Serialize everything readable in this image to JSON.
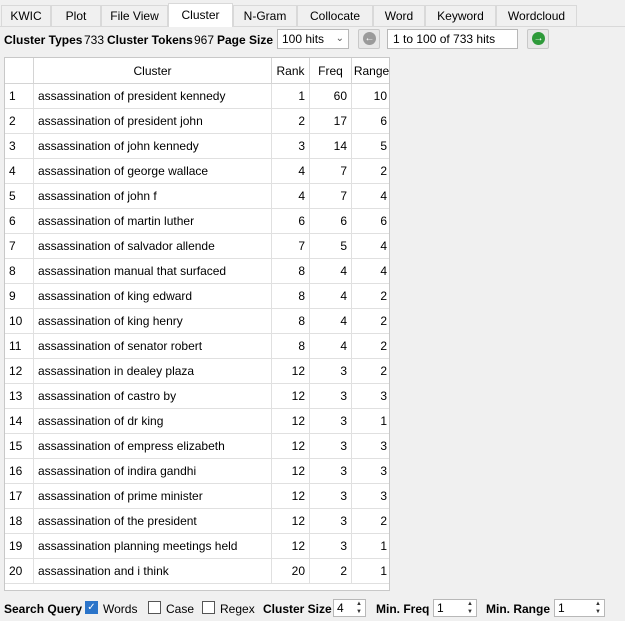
{
  "tabs": [
    {
      "label": "KWIC"
    },
    {
      "label": "Plot"
    },
    {
      "label": "File View"
    },
    {
      "label": "Cluster"
    },
    {
      "label": "N-Gram"
    },
    {
      "label": "Collocate"
    },
    {
      "label": "Word"
    },
    {
      "label": "Keyword"
    },
    {
      "label": "Wordcloud"
    }
  ],
  "active_tab": "Cluster",
  "toolbar": {
    "cluster_types_label": "Cluster Types",
    "cluster_types_value": "733",
    "cluster_tokens_label": "Cluster Tokens",
    "cluster_tokens_value": "967",
    "page_size_label": "Page Size",
    "page_size_value": "100 hits",
    "hits_range": "1 to 100 of 733 hits",
    "prev_icon": "arrow-left-circle-icon",
    "next_icon": "arrow-right-circle-icon",
    "prev_color": "#9a9a9a",
    "next_color": "#2e9a3a"
  },
  "table": {
    "headers": {
      "index": "",
      "cluster": "Cluster",
      "rank": "Rank",
      "freq": "Freq",
      "range": "Range"
    },
    "rows": [
      {
        "index": "1",
        "cluster": "assassination of president kennedy",
        "rank": "1",
        "freq": "60",
        "range": "10"
      },
      {
        "index": "2",
        "cluster": "assassination of president john",
        "rank": "2",
        "freq": "17",
        "range": "6"
      },
      {
        "index": "3",
        "cluster": "assassination of john kennedy",
        "rank": "3",
        "freq": "14",
        "range": "5"
      },
      {
        "index": "4",
        "cluster": "assassination of george wallace",
        "rank": "4",
        "freq": "7",
        "range": "2"
      },
      {
        "index": "5",
        "cluster": "assassination of john f",
        "rank": "4",
        "freq": "7",
        "range": "4"
      },
      {
        "index": "6",
        "cluster": "assassination of martin luther",
        "rank": "6",
        "freq": "6",
        "range": "6"
      },
      {
        "index": "7",
        "cluster": "assassination of salvador allende",
        "rank": "7",
        "freq": "5",
        "range": "4"
      },
      {
        "index": "8",
        "cluster": "assassination manual that surfaced",
        "rank": "8",
        "freq": "4",
        "range": "4"
      },
      {
        "index": "9",
        "cluster": "assassination of king edward",
        "rank": "8",
        "freq": "4",
        "range": "2"
      },
      {
        "index": "10",
        "cluster": "assassination of king henry",
        "rank": "8",
        "freq": "4",
        "range": "2"
      },
      {
        "index": "11",
        "cluster": "assassination of senator robert",
        "rank": "8",
        "freq": "4",
        "range": "2"
      },
      {
        "index": "12",
        "cluster": "assassination in dealey plaza",
        "rank": "12",
        "freq": "3",
        "range": "2"
      },
      {
        "index": "13",
        "cluster": "assassination of castro by",
        "rank": "12",
        "freq": "3",
        "range": "3"
      },
      {
        "index": "14",
        "cluster": "assassination of dr king",
        "rank": "12",
        "freq": "3",
        "range": "1"
      },
      {
        "index": "15",
        "cluster": "assassination of empress elizabeth",
        "rank": "12",
        "freq": "3",
        "range": "3"
      },
      {
        "index": "16",
        "cluster": "assassination of indira gandhi",
        "rank": "12",
        "freq": "3",
        "range": "3"
      },
      {
        "index": "17",
        "cluster": "assassination of prime minister",
        "rank": "12",
        "freq": "3",
        "range": "3"
      },
      {
        "index": "18",
        "cluster": "assassination of the president",
        "rank": "12",
        "freq": "3",
        "range": "2"
      },
      {
        "index": "19",
        "cluster": "assassination planning meetings held",
        "rank": "12",
        "freq": "3",
        "range": "1"
      },
      {
        "index": "20",
        "cluster": "assassination and i think",
        "rank": "20",
        "freq": "2",
        "range": "1"
      }
    ]
  },
  "bottom": {
    "search_query_label": "Search Query",
    "words_label": "Words",
    "words_checked": true,
    "case_label": "Case",
    "case_checked": false,
    "regex_label": "Regex",
    "regex_checked": false,
    "cluster_size_label": "Cluster Size",
    "cluster_size_value": "4",
    "min_freq_label": "Min. Freq",
    "min_freq_value": "1",
    "min_range_label": "Min. Range",
    "min_range_value": "1"
  }
}
